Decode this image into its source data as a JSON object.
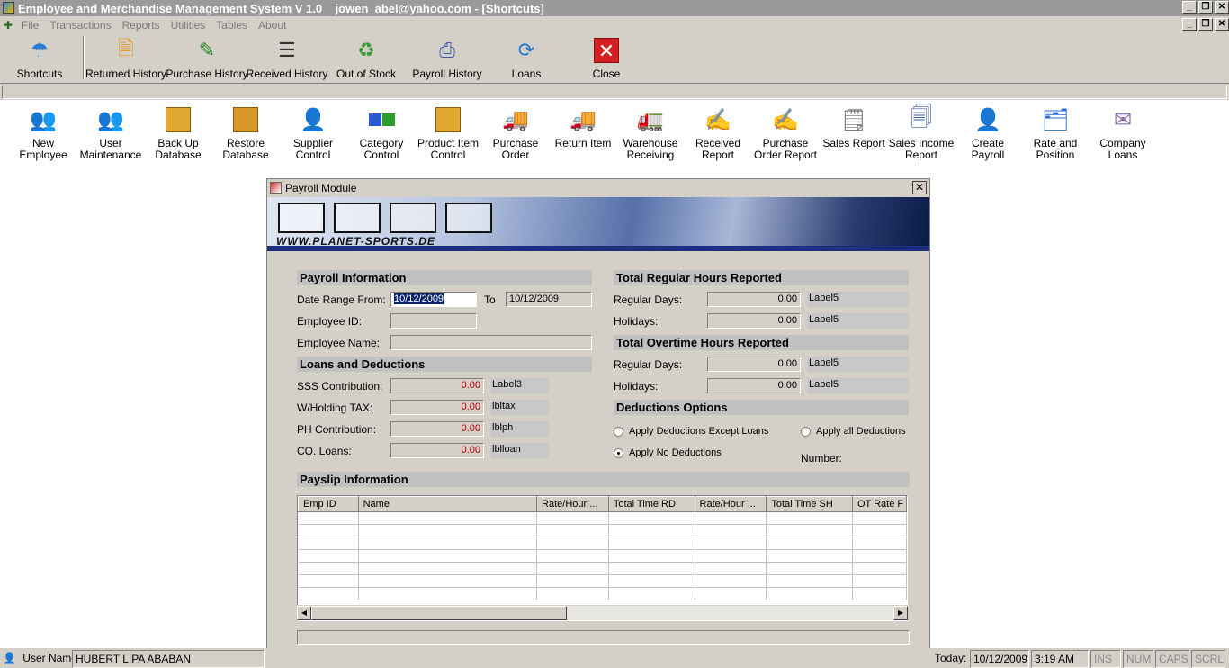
{
  "window": {
    "title": "Employee and Merchandise Management System V 1.0    jowen_abel@yahoo.com - [Shortcuts]"
  },
  "menu": [
    "File",
    "Transactions",
    "Reports",
    "Utilities",
    "Tables",
    "About"
  ],
  "toolbar": [
    {
      "label": "Shortcuts",
      "icon": "umbrella-icon"
    },
    {
      "label": "Returned History",
      "icon": "document-icon"
    },
    {
      "label": "Purchase History",
      "icon": "pencil-document-icon"
    },
    {
      "label": "Received History",
      "icon": "list-document-icon"
    },
    {
      "label": "Out of Stock",
      "icon": "recycle-bin-icon"
    },
    {
      "label": "Payroll History",
      "icon": "printer-icon"
    },
    {
      "label": "Loans",
      "icon": "refresh-icon"
    },
    {
      "label": "Close",
      "icon": "close-icon"
    }
  ],
  "shortcuts": [
    {
      "label": "New Employee",
      "icon": "users-icon"
    },
    {
      "label": "User\nMaintenance",
      "icon": "user-maintenance-icon"
    },
    {
      "label": "Back Up\nDatabase",
      "icon": "backup-box-icon"
    },
    {
      "label": "Restore\nDatabase",
      "icon": "restore-box-icon"
    },
    {
      "label": "Supplier\nControl",
      "icon": "supplier-icon"
    },
    {
      "label": "Category\nControl",
      "icon": "cubes-icon"
    },
    {
      "label": "Product Item\nControl",
      "icon": "box-icon"
    },
    {
      "label": "Purchase\nOrder",
      "icon": "truck-icon"
    },
    {
      "label": "Return Item",
      "icon": "return-truck-icon"
    },
    {
      "label": "Warehouse\nReceiving",
      "icon": "warehouse-icon"
    },
    {
      "label": "Received\nReport",
      "icon": "report-pen-icon"
    },
    {
      "label": "Purchase\nOrder Report",
      "icon": "order-report-icon"
    },
    {
      "label": "Sales Report",
      "icon": "sales-report-icon"
    },
    {
      "label": "Sales Income\nReport",
      "icon": "income-report-icon"
    },
    {
      "label": "Create Payroll",
      "icon": "payroll-user-icon"
    },
    {
      "label": "Rate and\nPosition",
      "icon": "rate-folder-icon"
    },
    {
      "label": "Company\nLoans",
      "icon": "loans-envelope-icon"
    }
  ],
  "payroll": {
    "title": "Payroll Module",
    "banner_site": "WWW.PLANET-SPORTS.DE",
    "sections": {
      "payroll_info": "Payroll Information",
      "loans": "Loans and Deductions",
      "regular_hours": "Total Regular Hours Reported",
      "overtime_hours": "Total Overtime Hours Reported",
      "deduction_options": "Deductions Options",
      "payslip": "Payslip Information"
    },
    "fields": {
      "date_from_label": "Date Range From:",
      "date_from": "10/12/2009",
      "to_label": "To",
      "date_to": "10/12/2009",
      "emp_id_label": "Employee ID:",
      "emp_name_label": "Employee Name:",
      "sss_label": "SSS Contribution:",
      "sss_value": "0.00",
      "sss_aux": "Label3",
      "wtax_label": "W/Holding TAX:",
      "wtax_value": "0.00",
      "wtax_aux": "lbltax",
      "ph_label": "PH Contribution:",
      "ph_value": "0.00",
      "ph_aux": "lblph",
      "coloans_label": "CO. Loans:",
      "coloans_value": "0.00",
      "coloans_aux": "lblloan",
      "reg_days_label": "Regular Days:",
      "reg_days_value": "0.00",
      "reg_days_aux": "Label5",
      "reg_hol_label": "Holidays:",
      "reg_hol_value": "0.00",
      "reg_hol_aux": "Label5",
      "ot_days_label": "Regular Days:",
      "ot_days_value": "0.00",
      "ot_days_aux": "Label5",
      "ot_hol_label": "Holidays:",
      "ot_hol_value": "0.00",
      "ot_hol_aux": "Label5"
    },
    "options": {
      "except_loans": "Apply Deductions Except Loans",
      "all": "Apply all Deductions",
      "none": "Apply No Deductions",
      "number_label": "Number:"
    },
    "grid_columns": [
      "Emp ID",
      "Name",
      "Rate/Hour ...",
      "Total Time RD",
      "Rate/Hour ...",
      "Total Time SH",
      "OT Rate F"
    ]
  },
  "status": {
    "user_label": "User Name:",
    "user_name": "HUBERT LIPA ABABAN",
    "today_label": "Today:",
    "date": "10/12/2009",
    "time": "3:19 AM",
    "ins": "INS",
    "num": "NUM",
    "caps": "CAPS",
    "scrl": "SCRL"
  }
}
